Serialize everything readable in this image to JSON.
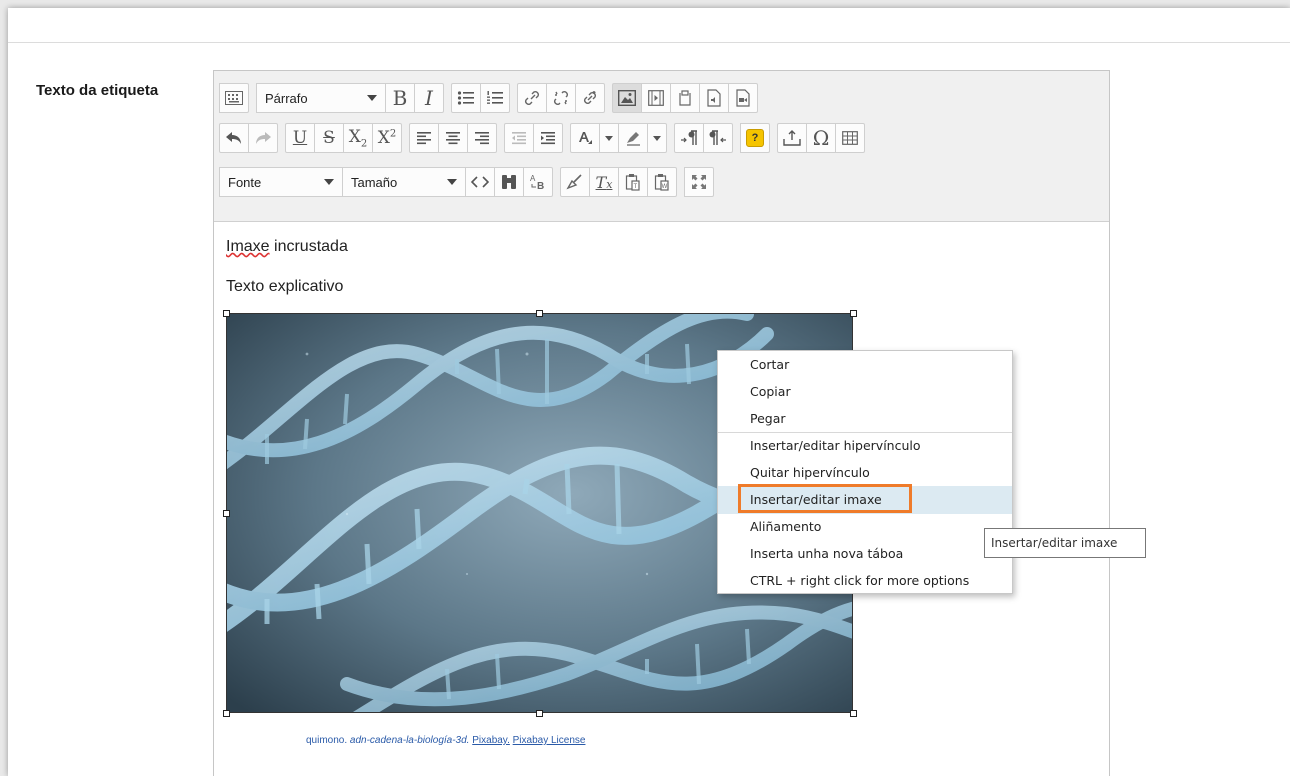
{
  "field_label": "Texto da etiqueta",
  "toolbar": {
    "format_combo": "Párrafo",
    "font_combo": "Fonte",
    "size_combo": "Tamaño",
    "help_symbol": "?"
  },
  "content": {
    "para1_spell": "Imaxe",
    "para1_rest": " incrustada",
    "para2": "Texto explicativo",
    "caption": {
      "author": "quimono.",
      "title": "adn-cadena-la-biología-3d.",
      "source": "Pixabay.",
      "license": "Pixabay License"
    }
  },
  "context_menu": {
    "items": [
      "Cortar",
      "Copiar",
      "Pegar",
      "Insertar/editar hipervínculo",
      "Quitar hipervínculo",
      "Insertar/editar imaxe",
      "Aliñamento",
      "Inserta unha nova táboa",
      "CTRL + right click for more options"
    ],
    "highlighted_index": 5
  },
  "tooltip": "Insertar/editar imaxe",
  "colors": {
    "highlight_border": "#ef7b2a",
    "menu_highlight": "#dceaf2",
    "caption_link": "#2a5aa8"
  }
}
